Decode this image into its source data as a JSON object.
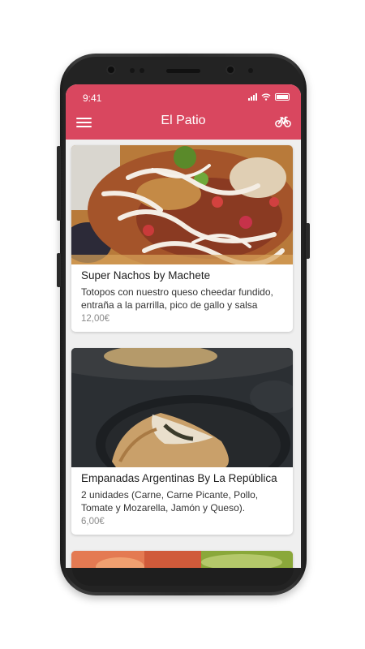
{
  "status": {
    "time": "9:41"
  },
  "header": {
    "title": "El Patio",
    "menu_icon": "hamburger-menu-icon",
    "delivery_icon": "bicycle-icon",
    "color": "#d9475f"
  },
  "products": [
    {
      "title": "Super Nachos by Machete",
      "description": "Totopos con nuestro queso cheedar fundido, entraña a la parrilla, pico de gallo y salsa",
      "price": "12,00€"
    },
    {
      "title": "Empanadas Argentinas By La República",
      "description": "2 unidades (Carne, Carne Picante, Pollo, Tomate y Mozarella, Jamón y Queso).",
      "price": "6,00€"
    }
  ]
}
